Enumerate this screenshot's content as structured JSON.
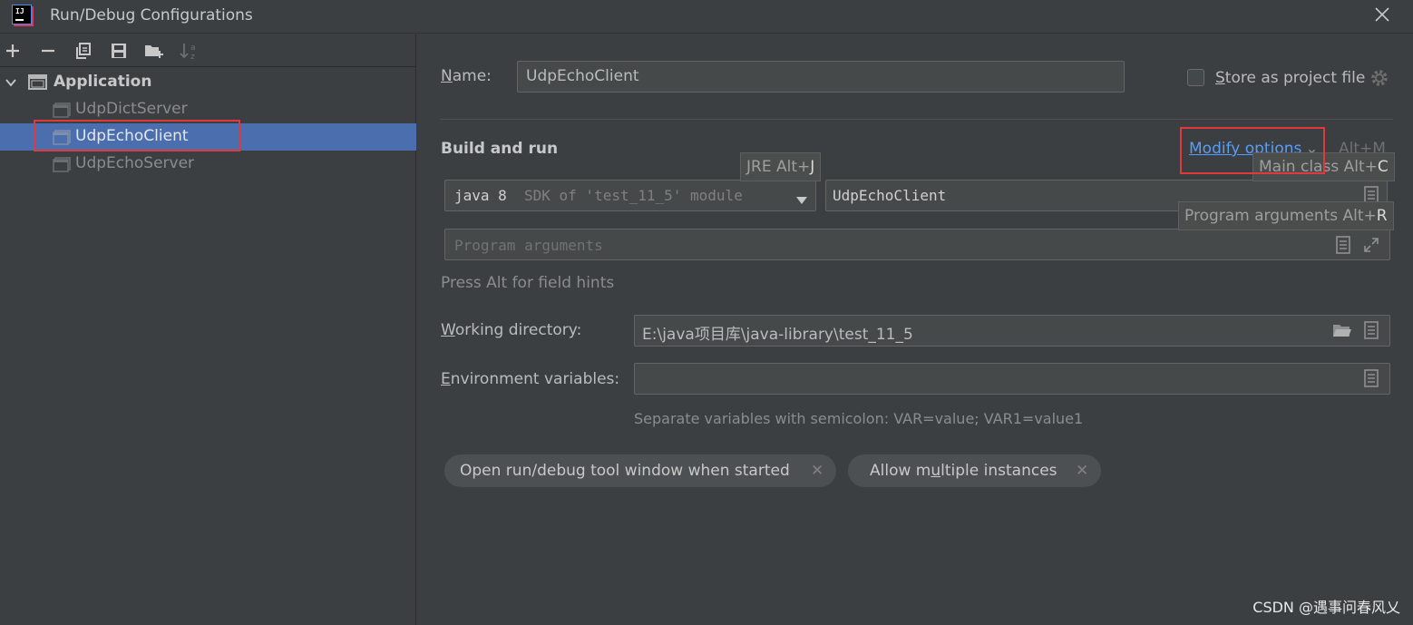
{
  "window": {
    "title": "Run/Debug Configurations",
    "app_icon_text": "IJ"
  },
  "toolbar": {
    "icons": [
      "add-icon",
      "remove-icon",
      "copy-icon",
      "save-icon",
      "new-folder-icon",
      "sort-icon"
    ]
  },
  "tree": {
    "group_label": "Application",
    "items": [
      {
        "label": "UdpDictServer",
        "selected": false
      },
      {
        "label": "UdpEchoClient",
        "selected": true
      },
      {
        "label": "UdpEchoServer",
        "selected": false
      }
    ]
  },
  "form": {
    "name_label_first": "N",
    "name_label_rest": "ame:",
    "name_value": "UdpEchoClient",
    "store_label_first": "S",
    "store_label_rest": "tore as project file",
    "store_checked": false,
    "section_title": "Build and run",
    "modify_first": "M",
    "modify_rest": "odify options",
    "modify_chevron": "⌄",
    "modify_shortcut": "Alt+M",
    "jre_hint_prefix": "JRE Alt+",
    "jre_hint_key": "J",
    "main_class_hint_prefix": "Main class Alt+",
    "main_class_hint_key": "C",
    "program_args_hint_prefix": "Program arguments Alt+",
    "program_args_hint_key": "R",
    "jre_main": "java 8",
    "jre_detail": "SDK of 'test_11_5' module",
    "main_class_value": "UdpEchoClient",
    "program_args_placeholder": "Program arguments",
    "press_alt_hint": "Press Alt for field hints",
    "workdir_label_first": "W",
    "workdir_label_rest": "orking directory:",
    "workdir_value": "E:\\java项目库\\java-library\\test_11_5",
    "env_label_first": "E",
    "env_label_rest": "nvironment variables:",
    "env_value": "",
    "env_hint": "Separate variables with semicolon: VAR=value; VAR1=value1"
  },
  "chips": [
    {
      "label": "Open run/debug tool window when started"
    },
    {
      "label_a": "Allow m",
      "label_u": "u",
      "label_b": "ltiple instances"
    }
  ],
  "watermark": "CSDN @遇事问春风乂",
  "colors": {
    "background": "#3c3f41",
    "selection": "#4b6eaf",
    "link": "#589df6",
    "highlight_box": "#e0393e"
  }
}
